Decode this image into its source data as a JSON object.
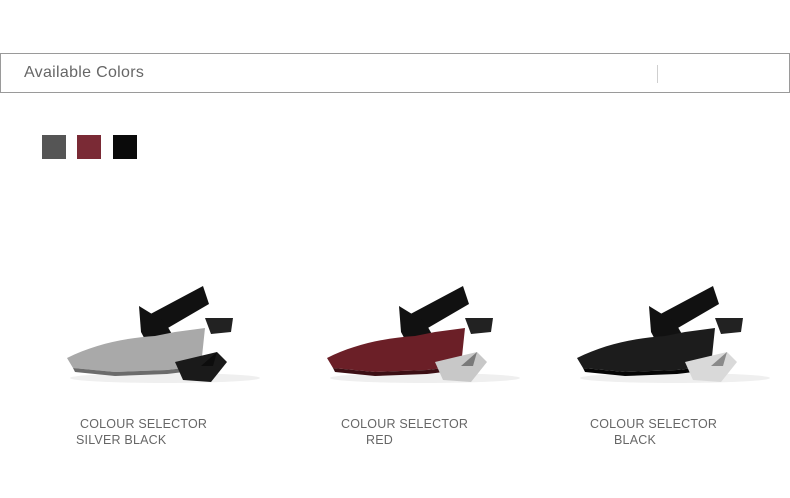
{
  "header": {
    "title": "Available Colors"
  },
  "swatches": [
    {
      "color": "#555555"
    },
    {
      "color": "#7a2a35"
    },
    {
      "color": "#0a0a0a"
    }
  ],
  "products": [
    {
      "caption_line1": "COLOUR SELECTOR",
      "caption_line2": "SILVER BLACK",
      "toe_color": "#a9a9a9",
      "toe_shade": "#6b6b6b",
      "heel_color": "#1a1a1a",
      "heel_accent": "#0d0d0d"
    },
    {
      "caption_line1": "COLOUR SELECTOR",
      "caption_line2": "RED",
      "toe_color": "#6b1f27",
      "toe_shade": "#3c0f14",
      "heel_color": "#c8c8c8",
      "heel_accent": "#7a7a7a"
    },
    {
      "caption_line1": "COLOUR SELECTOR",
      "caption_line2": "BLACK",
      "toe_color": "#1c1c1c",
      "toe_shade": "#050505",
      "heel_color": "#d9d9d9",
      "heel_accent": "#8a8a8a"
    }
  ]
}
